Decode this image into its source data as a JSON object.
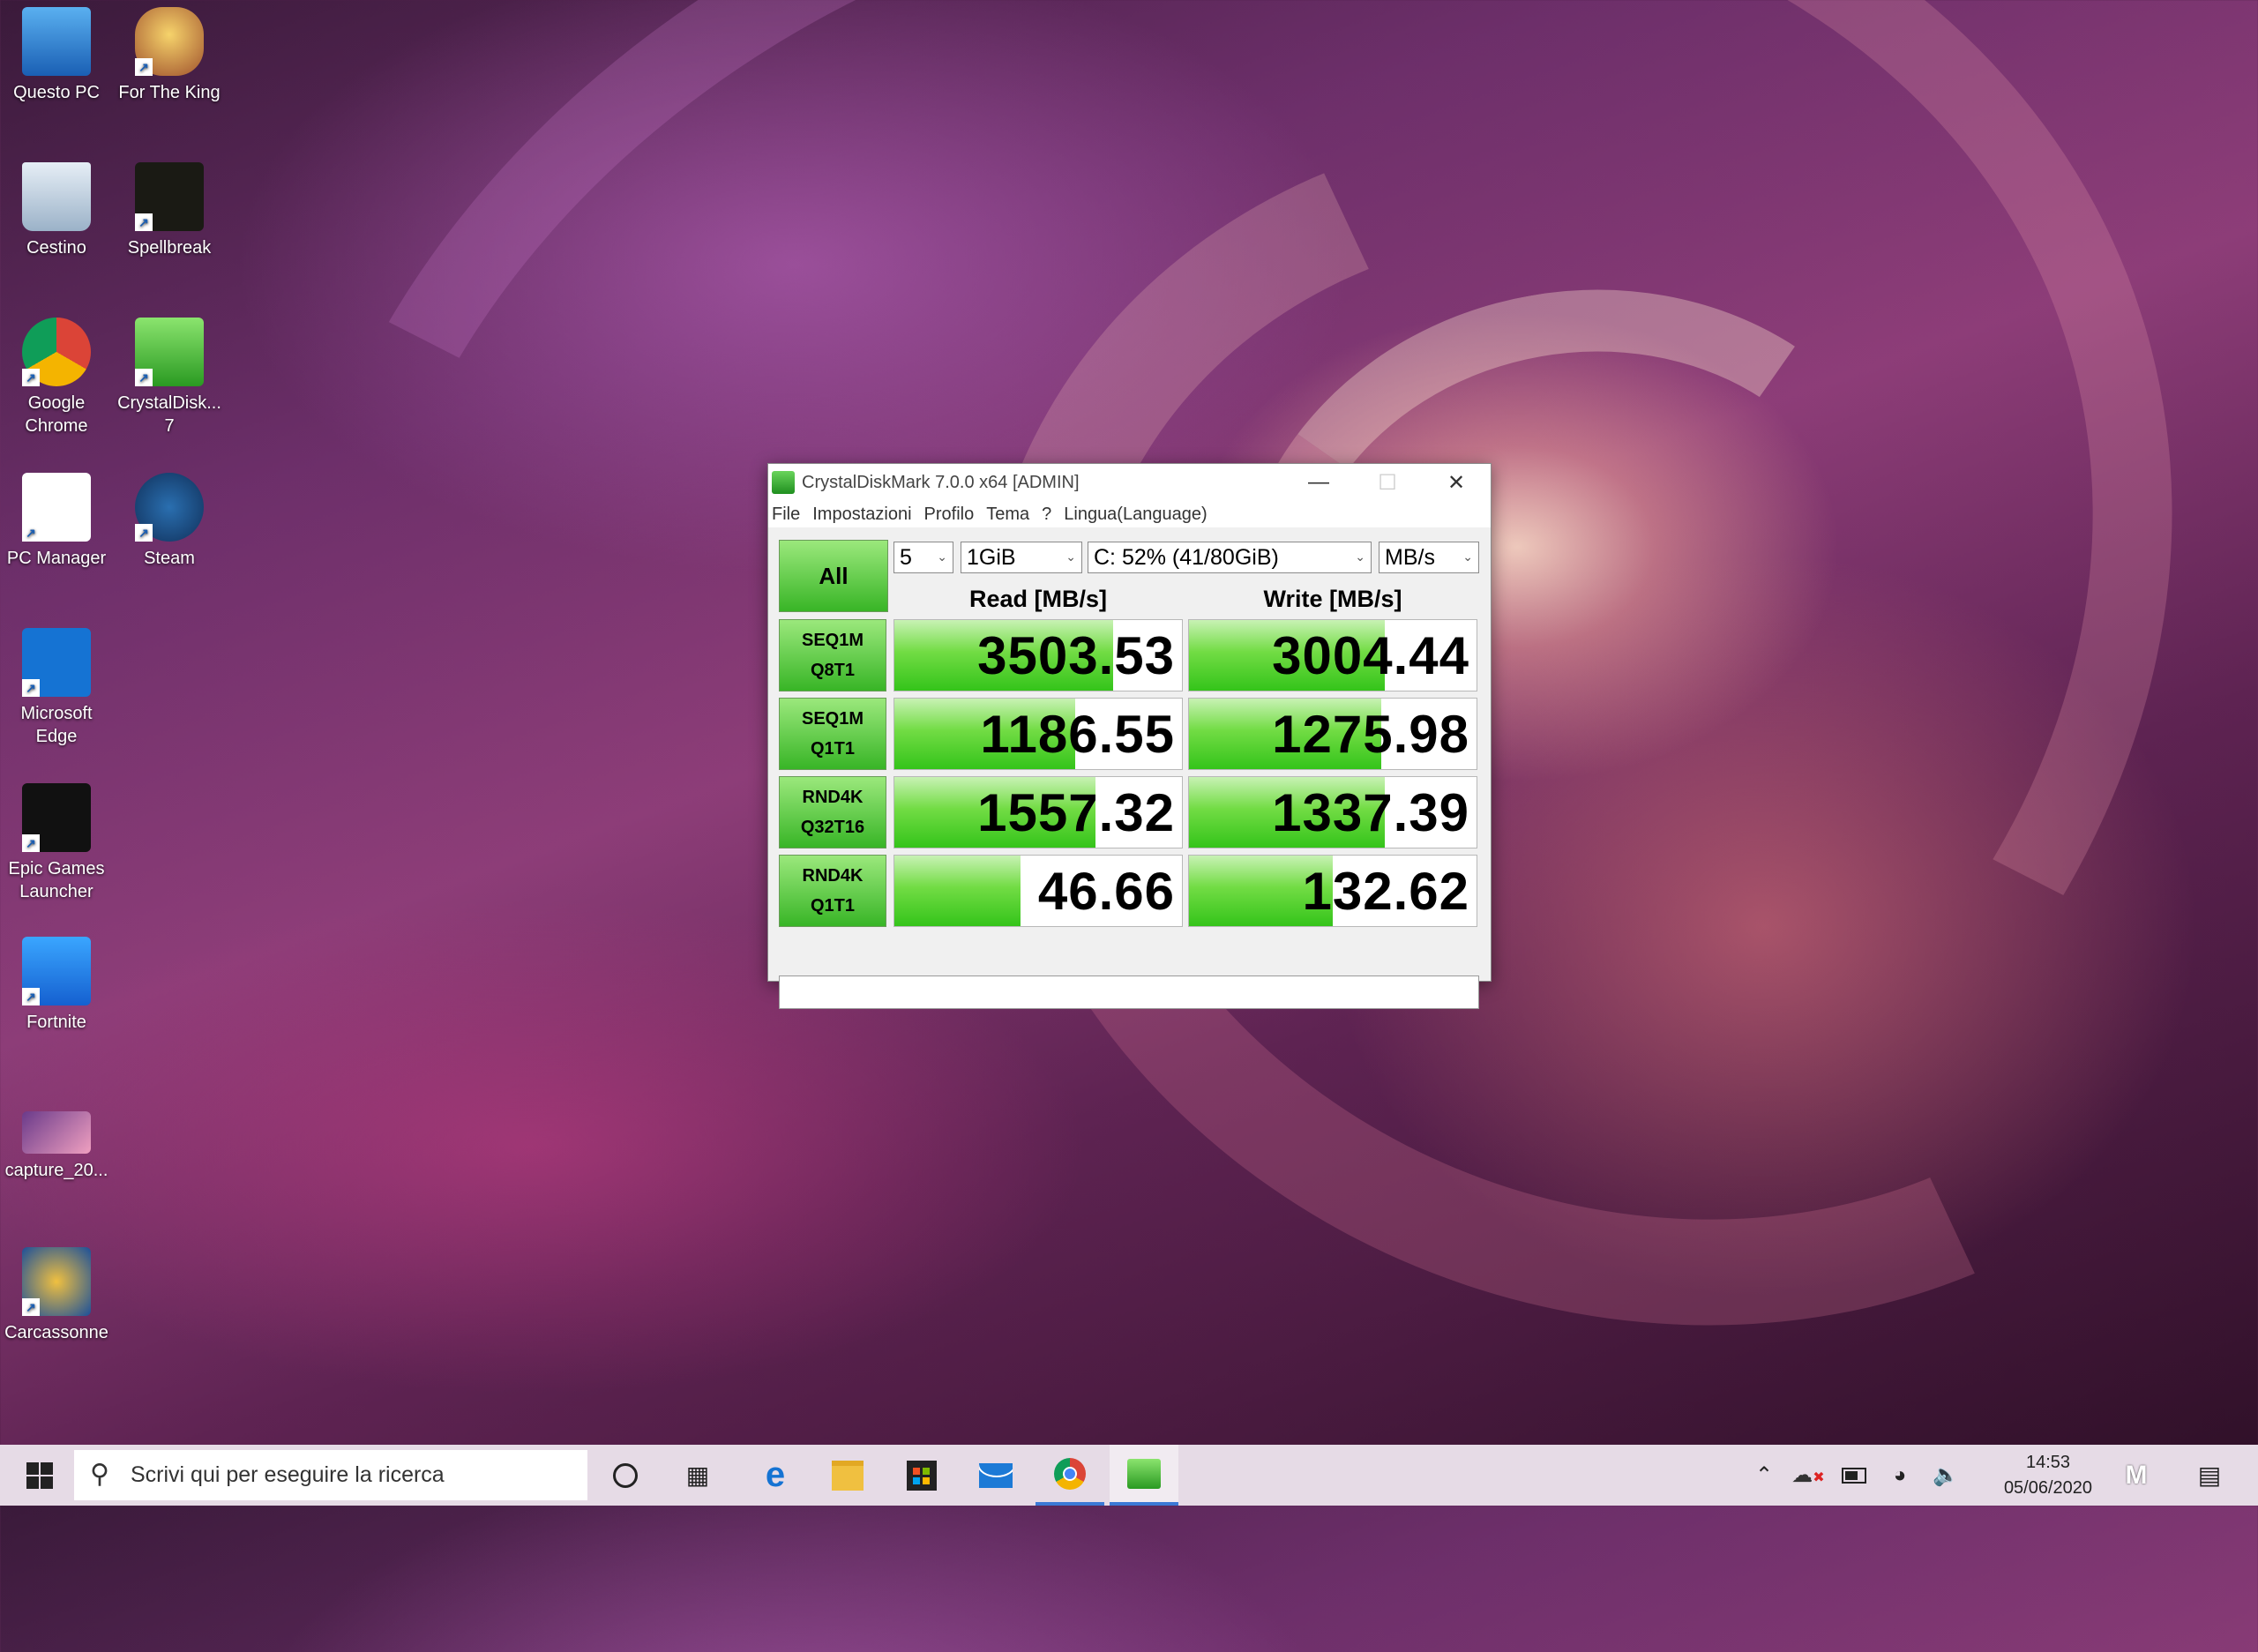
{
  "desktop": {
    "icons": [
      {
        "label": "Questo PC",
        "icon": "computer-icon"
      },
      {
        "label": "For The King",
        "icon": "crown-game-icon"
      },
      {
        "label": "Cestino",
        "icon": "recycle-bin-icon"
      },
      {
        "label": "Spellbreak",
        "icon": "spellbreak-game-icon"
      },
      {
        "label": "Google Chrome",
        "icon": "chrome-icon"
      },
      {
        "label": "CrystalDisk... 7",
        "icon": "crystaldisk-icon"
      },
      {
        "label": "PC Manager",
        "icon": "pc-manager-icon"
      },
      {
        "label": "Steam",
        "icon": "steam-icon"
      },
      {
        "label": "Microsoft Edge",
        "icon": "edge-icon"
      },
      {
        "label": "Epic Games Launcher",
        "icon": "epic-games-icon"
      },
      {
        "label": "Fortnite",
        "icon": "fortnite-icon"
      },
      {
        "label": "capture_20...",
        "icon": "image-file-icon"
      },
      {
        "label": "Carcassonne",
        "icon": "carcassonne-icon"
      }
    ]
  },
  "window": {
    "title": "CrystalDiskMark 7.0.0 x64 [ADMIN]",
    "menu": [
      "File",
      "Impostazioni",
      "Profilo",
      "Tema",
      "?",
      "Lingua(Language)"
    ],
    "all_button": "All",
    "count_select": "5",
    "size_select": "1GiB",
    "drive_select": "C: 52% (41/80GiB)",
    "unit_select": "MB/s",
    "read_header": "Read [MB/s]",
    "write_header": "Write [MB/s]",
    "rows": [
      {
        "line1": "SEQ1M",
        "line2": "Q8T1",
        "read": "3503.53",
        "write": "3004.44",
        "read_fill": 0.76,
        "write_fill": 0.68
      },
      {
        "line1": "SEQ1M",
        "line2": "Q1T1",
        "read": "1186.55",
        "write": "1275.98",
        "read_fill": 0.63,
        "write_fill": 0.67
      },
      {
        "line1": "RND4K",
        "line2": "Q32T16",
        "read": "1557.32",
        "write": "1337.39",
        "read_fill": 0.7,
        "write_fill": 0.68
      },
      {
        "line1": "RND4K",
        "line2": "Q1T1",
        "read": "46.66",
        "write": "132.62",
        "read_fill": 0.44,
        "write_fill": 0.5
      }
    ]
  },
  "taskbar": {
    "search_placeholder": "Scrivi qui per eseguire la ricerca",
    "time": "14:53",
    "date": "05/06/2020"
  }
}
